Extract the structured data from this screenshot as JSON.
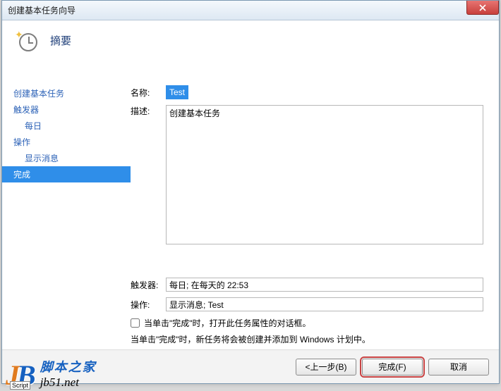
{
  "window": {
    "title": "创建基本任务向导"
  },
  "header": {
    "title": "摘要"
  },
  "sidebar": {
    "items": [
      {
        "label": "创建基本任务",
        "sub": false,
        "current": false
      },
      {
        "label": "触发器",
        "sub": false,
        "current": false
      },
      {
        "label": "每日",
        "sub": true,
        "current": false
      },
      {
        "label": "操作",
        "sub": false,
        "current": false
      },
      {
        "label": "显示消息",
        "sub": true,
        "current": false
      },
      {
        "label": "完成",
        "sub": false,
        "current": true
      }
    ]
  },
  "form": {
    "name_label": "名称:",
    "name_value": "Test",
    "desc_label": "描述:",
    "desc_value": "创建基本任务",
    "trigger_label": "触发器:",
    "trigger_value": "每日; 在每天的 22:53",
    "action_label": "操作:",
    "action_value": "显示消息; Test",
    "checkbox_label": "当单击\"完成\"时，打开此任务属性的对话框。",
    "note": "当单击\"完成\"时，新任务将会被创建并添加到 Windows 计划中。"
  },
  "buttons": {
    "back": "<上一步(B)",
    "finish": "完成(F)",
    "cancel": "取消"
  },
  "watermark": {
    "cn": "脚本之家",
    "url": "jb51.net",
    "tag": "Script"
  }
}
